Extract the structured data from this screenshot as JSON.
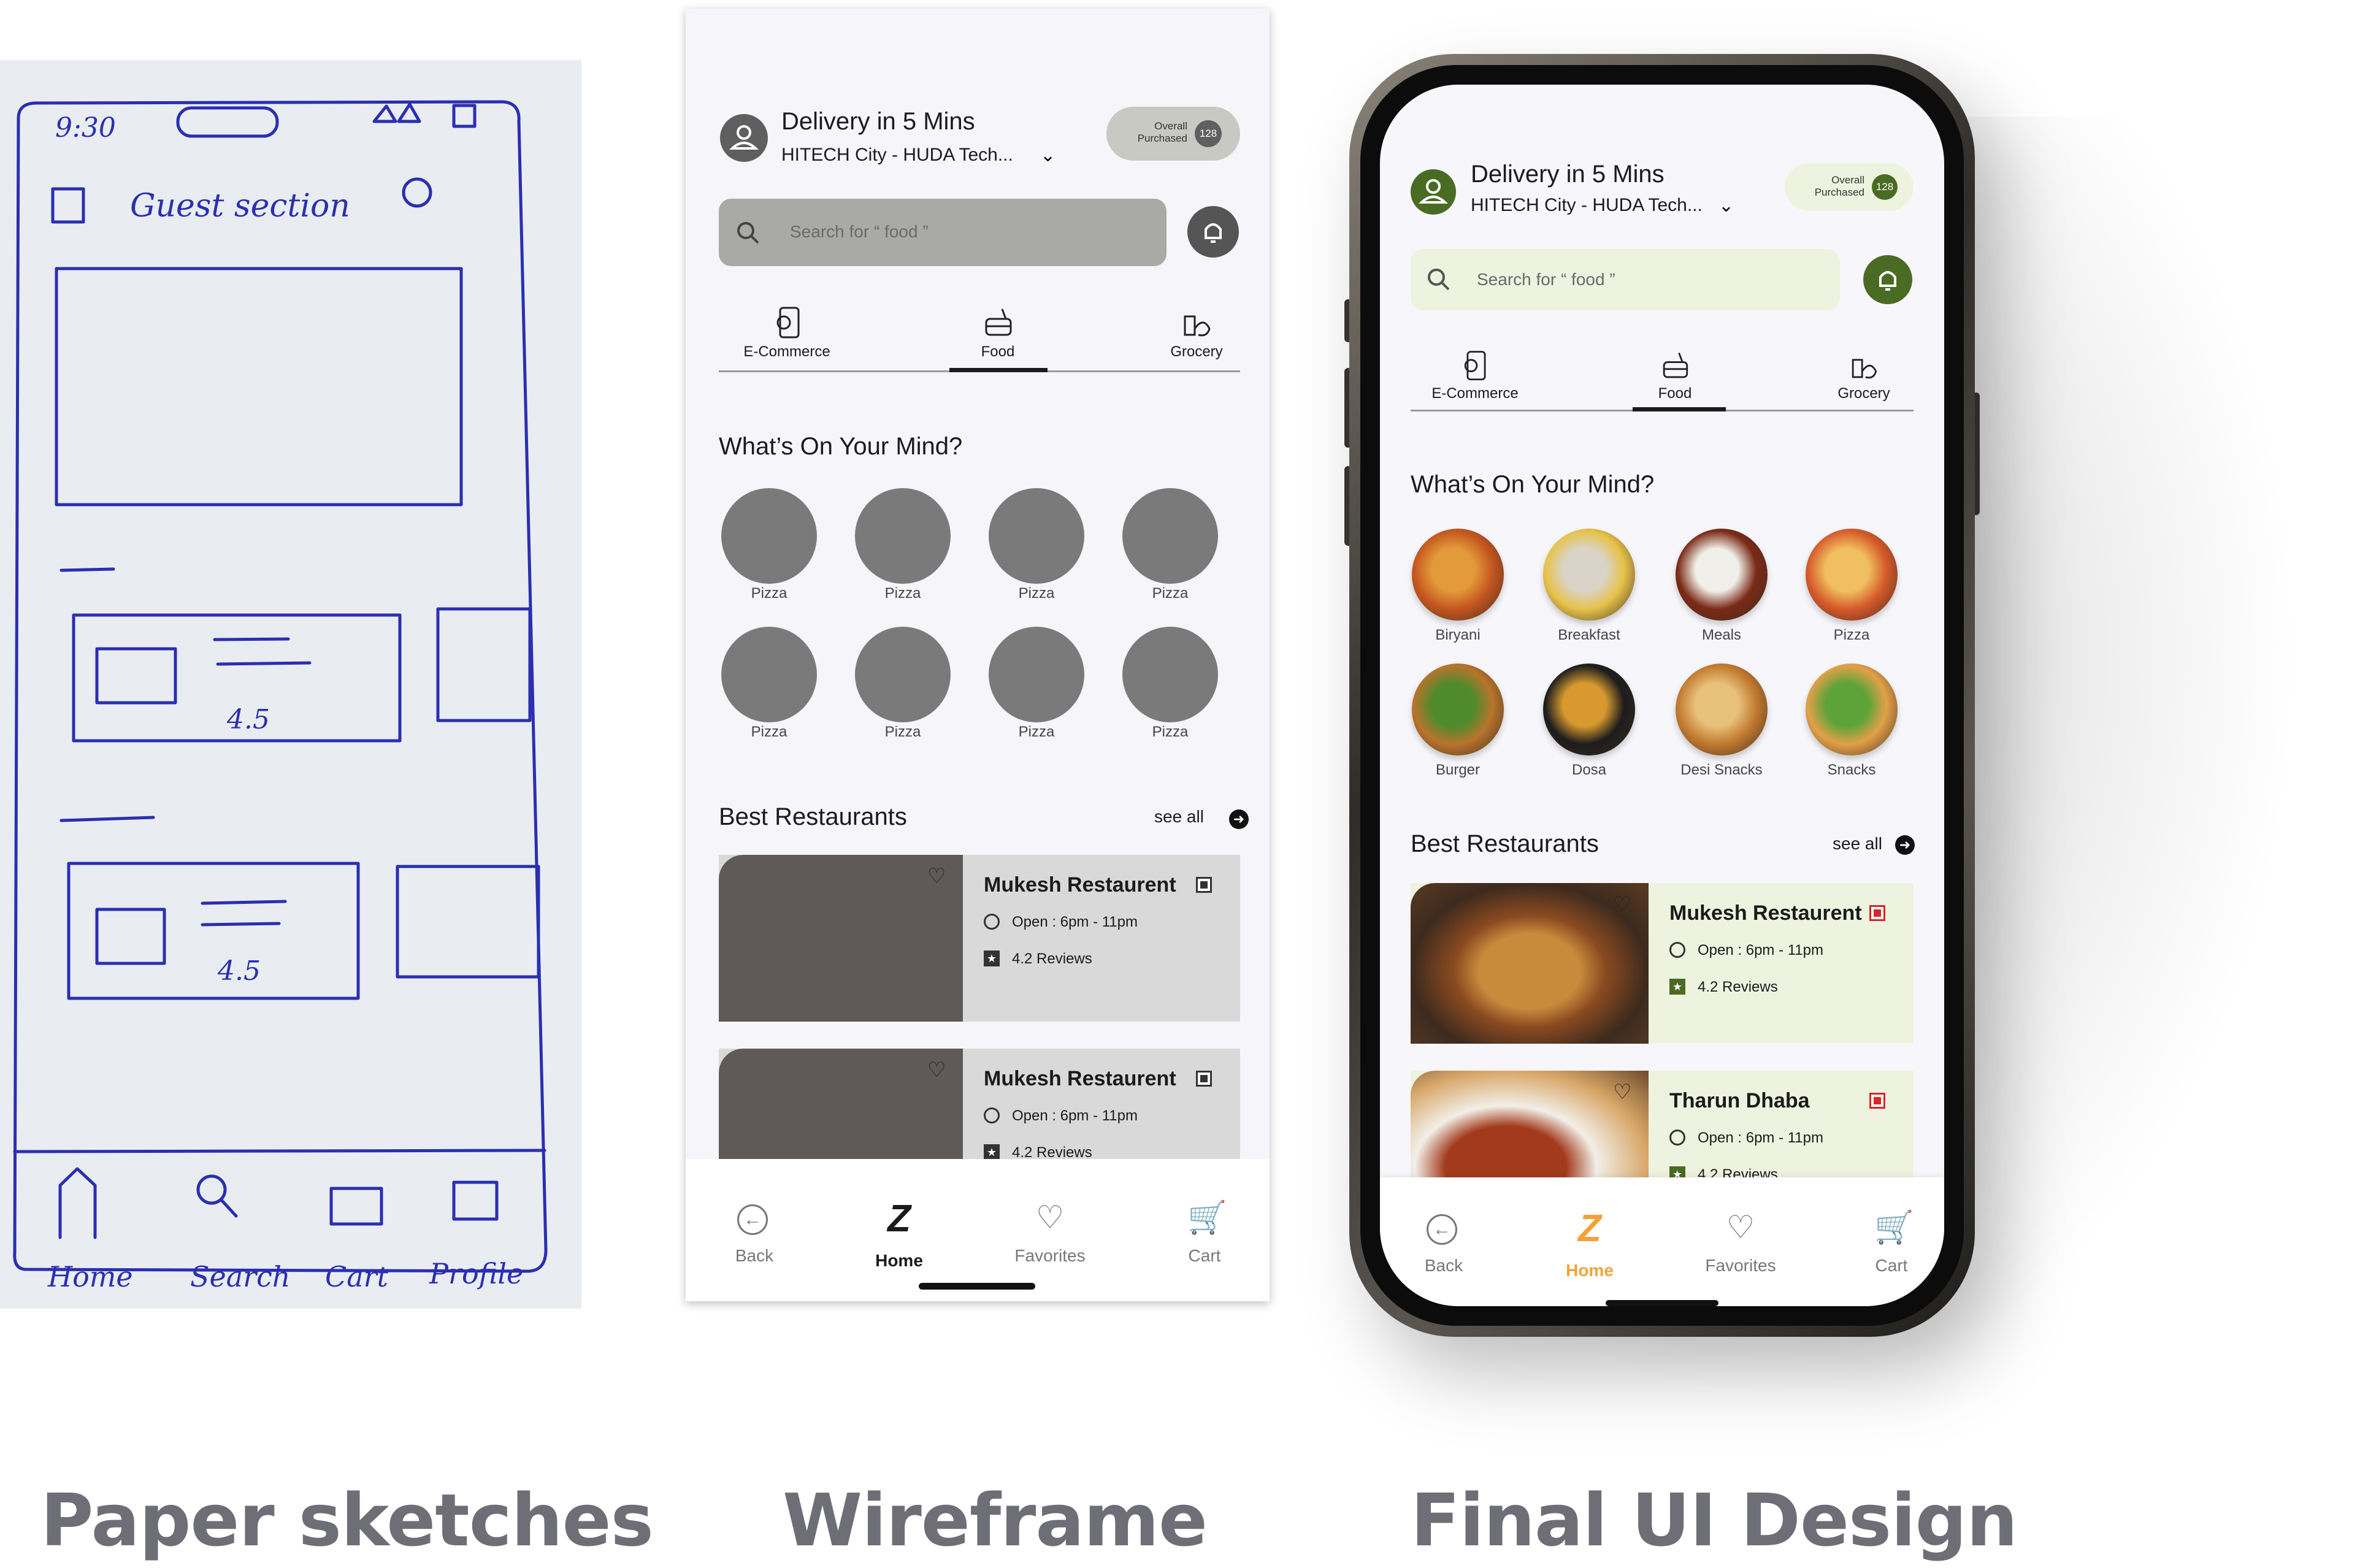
{
  "captions": {
    "sketch": "Paper sketches",
    "wireframe": "Wireframe",
    "final": "Final UI Design"
  },
  "sketch": {
    "status_time": "9:30",
    "guest_label": "Guest section",
    "rating_1": "4.5",
    "rating_2": "4.5",
    "nav": [
      "Home",
      "Search",
      "Cart",
      "Profile"
    ]
  },
  "header": {
    "title": "Delivery in 5 Mins",
    "location": "HITECH City - HUDA Tech...",
    "overall_label_1": "Overall",
    "overall_label_2": "Purchased",
    "overall_count": "128"
  },
  "search": {
    "placeholder": "Search for “ food ”"
  },
  "categories": [
    "E-Commerce",
    "Food",
    "Grocery"
  ],
  "mind": {
    "title": "What’s On Your Mind?",
    "wireframe_items": [
      "Pizza",
      "Pizza",
      "Pizza",
      "Pizza",
      "Pizza",
      "Pizza",
      "Pizza",
      "Pizza"
    ],
    "final_items": [
      "Biryani",
      "Breakfast",
      "Meals",
      "Pizza",
      "Burger",
      "Dosa",
      "Desi Snacks",
      "Snacks"
    ]
  },
  "restaurants": {
    "title": "Best Restaurants",
    "see_all": "see all",
    "wireframe_cards": [
      {
        "name": "Mukesh Restaurent",
        "hours": "Open : 6pm - 11pm",
        "reviews": "4.2 Reviews"
      },
      {
        "name": "Mukesh Restaurent",
        "hours": "Open : 6pm - 11pm",
        "reviews": "4.2 Reviews"
      }
    ],
    "final_cards": [
      {
        "name": "Mukesh Restaurent",
        "hours": "Open : 6pm - 11pm",
        "reviews": "4.2 Reviews"
      },
      {
        "name": "Tharun Dhaba",
        "hours": "Open : 6pm - 11pm",
        "reviews": "4.2 Reviews"
      }
    ]
  },
  "bottom_nav": [
    "Back",
    "Home",
    "Favorites",
    "Cart"
  ],
  "colors": {
    "brand_green": "#4a6b24",
    "brand_light": "#eef3df",
    "brand_orange": "#f2a23a",
    "wire_gray": "#7a7a7a",
    "wire_dark": "#5f5a58"
  }
}
